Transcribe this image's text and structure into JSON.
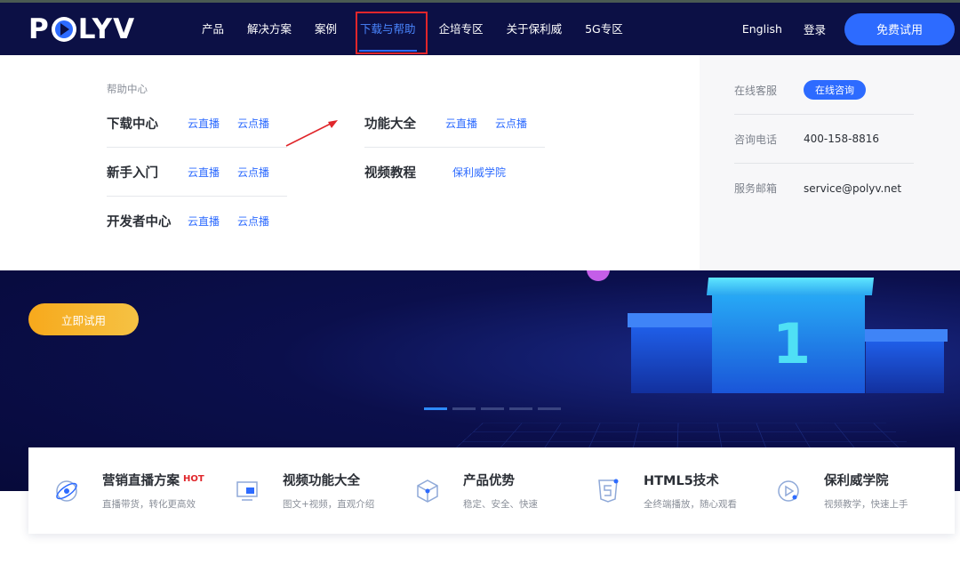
{
  "logo": {
    "text_left": "P",
    "text_right": "LYV"
  },
  "nav": {
    "items": [
      {
        "label": "产品"
      },
      {
        "label": "解决方案"
      },
      {
        "label": "案例"
      },
      {
        "label": "下载与帮助"
      },
      {
        "label": "企培专区"
      },
      {
        "label": "关于保利威"
      },
      {
        "label": "5G专区"
      }
    ],
    "active_item": "下载与帮助",
    "language": "English",
    "login": "登录",
    "trial_button": "免费试用"
  },
  "dropdown": {
    "heading": "帮助中心",
    "left_column": [
      {
        "title": "下载中心",
        "links": [
          "云直播",
          "云点播"
        ]
      },
      {
        "title": "新手入门",
        "links": [
          "云直播",
          "云点播"
        ]
      },
      {
        "title": "开发者中心",
        "links": [
          "云直播",
          "云点播"
        ]
      }
    ],
    "right_column": [
      {
        "title": "功能大全",
        "links": [
          "云直播",
          "云点播"
        ]
      },
      {
        "title": "视频教程",
        "links": [
          "保利威学院"
        ]
      }
    ],
    "contact": {
      "online_service_label": "在线客服",
      "online_service_button": "在线咨询",
      "phone_label": "咨询电话",
      "phone_value": "400-158-8816",
      "email_label": "服务邮箱",
      "email_value": "service@polyv.net"
    }
  },
  "hero": {
    "try_button": "立即试用",
    "podium_numeral": "1",
    "carousel": {
      "count": 5,
      "active_index": 0
    }
  },
  "features": [
    {
      "title": "营销直播方案",
      "badge": "HOT",
      "desc": "直播带货，转化更高效",
      "icon": "live-marketing-icon"
    },
    {
      "title": "视频功能大全",
      "badge": "",
      "desc": "图文+视频，直观介绍",
      "icon": "monitor-icon"
    },
    {
      "title": "产品优势",
      "badge": "",
      "desc": "稳定、安全、快速",
      "icon": "cube-icon"
    },
    {
      "title": "HTML5技术",
      "badge": "",
      "desc": "全终端播放，随心观看",
      "icon": "html5-icon"
    },
    {
      "title": "保利威学院",
      "badge": "",
      "desc": "视频教学，快速上手",
      "icon": "play-circle-icon"
    }
  ],
  "colors": {
    "nav_bg": "#0c1045",
    "accent_blue": "#2d6bff",
    "highlight_red": "#e0262b",
    "cta_orange": "#f7a91c"
  }
}
